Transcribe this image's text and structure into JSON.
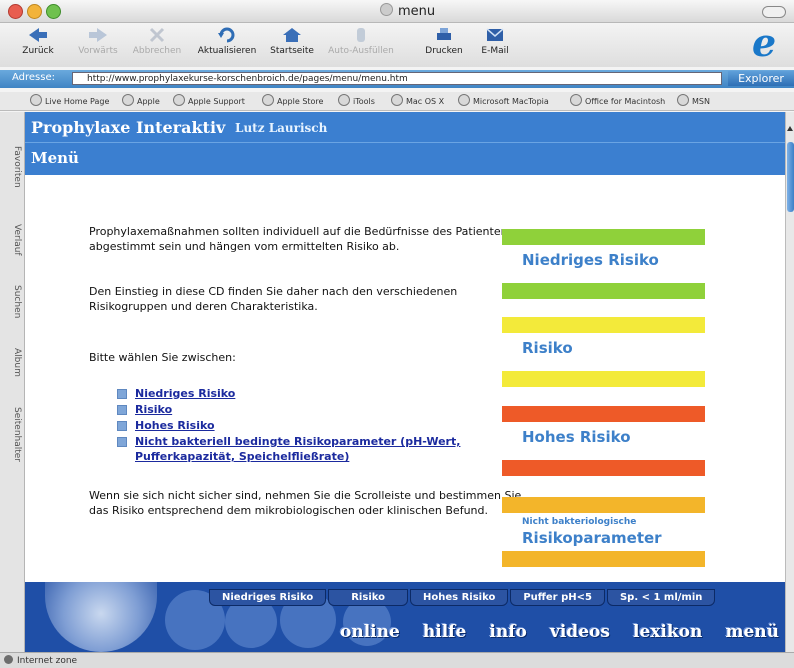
{
  "window": {
    "title": "menu"
  },
  "toolbar": {
    "buttons": [
      {
        "label": "Zurück",
        "icon": "back-arrow-icon",
        "enabled": true
      },
      {
        "label": "Vorwärts",
        "icon": "forward-arrow-icon",
        "enabled": false
      },
      {
        "label": "Abbrechen",
        "icon": "stop-x-icon",
        "enabled": false
      },
      {
        "label": "Aktualisieren",
        "icon": "refresh-icon",
        "enabled": true
      },
      {
        "label": "Startseite",
        "icon": "home-icon",
        "enabled": true
      },
      {
        "label": "Auto-Ausfüllen",
        "icon": "autofill-icon",
        "enabled": false
      },
      {
        "label": "Drucken",
        "icon": "printer-icon",
        "enabled": true
      },
      {
        "label": "E-Mail",
        "icon": "mail-icon",
        "enabled": true
      }
    ]
  },
  "address": {
    "label": "Adresse:",
    "url": "http://www.prophylaxekurse-korschenbroich.de/pages/menu/menu.htm",
    "explorer_button": "Explorer"
  },
  "favorites": [
    "Live Home Page",
    "Apple",
    "Apple Support",
    "Apple Store",
    "iTools",
    "Mac OS X",
    "Microsoft MacTopia",
    "Office for Macintosh",
    "MSN"
  ],
  "sidebar_tabs": [
    "Favoriten",
    "Verlauf",
    "Suchen",
    "Album",
    "Seitenhalter"
  ],
  "page": {
    "banner_title": "Prophylaxe Interaktiv",
    "banner_author": "Lutz Laurisch",
    "section_title": "Menü",
    "intro_text": "Prophylaxemaßnahmen sollten individuell auf die Bedürfnisse des Patienten abgestimmt sein und hängen vom ermittelten Risiko ab.",
    "entry_text": "Den Einstieg in diese CD finden Sie daher nach den verschiedenen Risikogruppen und deren Charakteristika.",
    "choose_text": "Bitte wählen Sie zwischen:",
    "links": [
      "Niedriges Risiko",
      "Risiko",
      "Hohes Risiko",
      "Nicht bakteriell bedingte Risikoparameter (pH-Wert, Pufferkapazität, Speichelfließrate)"
    ],
    "unsure_text": "Wenn sie sich nicht sicher sind, nehmen Sie die Scrolleiste und bestimmen Sie das Risiko entsprechend dem mikrobiologischen oder klinischen Befund.",
    "risk_cards": [
      {
        "label": "Niedriges Risiko",
        "color": "#8fd13a"
      },
      {
        "label": "Risiko",
        "color": "#f3ea3a"
      },
      {
        "label": "Hohes Risiko",
        "color": "#ee5a28"
      },
      {
        "label_small": "Nicht bakteriologische",
        "label": "Risikoparameter",
        "color": "#f3b52a"
      }
    ]
  },
  "footer": {
    "tabs": [
      "Niedriges Risiko",
      "Risiko",
      "Hohes Risiko",
      "Puffer pH<5",
      "Sp. < 1 ml/min"
    ],
    "nav": [
      "online",
      "hilfe",
      "info",
      "videos",
      "lexikon",
      "menü"
    ]
  },
  "status": {
    "text": "Internet zone"
  }
}
